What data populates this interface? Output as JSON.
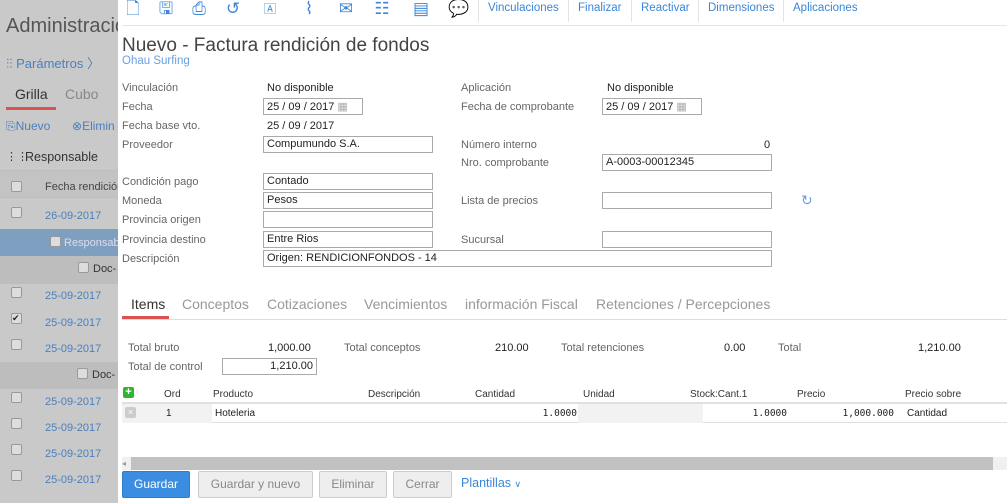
{
  "background": {
    "title": "Administració",
    "params": "Parámetros",
    "tabs": [
      "Grilla",
      "Cubo"
    ],
    "nuevo": "Nuevo",
    "eliminar": "Elimin",
    "group": "Responsable",
    "col_header": "Fecha rendición",
    "group_row": "Responsab",
    "doc_row": "Doc-",
    "rows": [
      "26-09-2017",
      "25-09-2017",
      "25-09-2017",
      "25-09-2017",
      "25-09-2017",
      "25-09-2017",
      "25-09-2017",
      "25-09-2017"
    ]
  },
  "toolbar": {
    "icons": [
      "new-doc-icon",
      "save-icon",
      "print-icon",
      "history-icon",
      "font-doc-icon",
      "attach-icon",
      "mail-icon",
      "checklist-icon",
      "document-icon",
      "comment-icon"
    ],
    "links": [
      "Vinculaciones",
      "Finalizar",
      "Reactivar",
      "Dimensiones",
      "Aplicaciones"
    ]
  },
  "header": {
    "title": "Nuevo - Factura rendición de fondos",
    "subtitle": "Ohau Surfing"
  },
  "form": {
    "vinculacion_label": "Vinculación",
    "vinculacion": "No disponible",
    "aplicacion_label": "Aplicación",
    "aplicacion": "No disponible",
    "fecha_label": "Fecha",
    "fecha": {
      "d": "25",
      "m": "09",
      "y": "2017"
    },
    "fecha_comp_label": "Fecha de comprobante",
    "fecha_comp": {
      "d": "25",
      "m": "09",
      "y": "2017"
    },
    "fecha_vto_label": "Fecha base vto.",
    "fecha_vto": "25 / 09 / 2017",
    "proveedor_label": "Proveedor",
    "proveedor": "Compumundo S.A.",
    "num_interno_label": "Número interno",
    "num_interno": "0",
    "nro_comp_label": "Nro. comprobante",
    "nro_comp": "A-0003-00012345",
    "condicion_label": "Condición pago",
    "condicion": "Contado",
    "moneda_label": "Moneda",
    "moneda": "Pesos",
    "lista_label": "Lista de precios",
    "lista": "",
    "prov_origen_label": "Provincia origen",
    "prov_origen": "",
    "prov_destino_label": "Provincia destino",
    "prov_destino": "Entre Rios",
    "sucursal_label": "Sucursal",
    "sucursal": "",
    "descripcion_label": "Descripción",
    "descripcion": "Origen: RENDICIONFONDOS - 14"
  },
  "tabs": [
    "Items",
    "Conceptos",
    "Cotizaciones",
    "Vencimientos",
    "información Fiscal",
    "Retenciones / Percepciones"
  ],
  "totals": {
    "bruto_label": "Total bruto",
    "bruto": "1,000.00",
    "conceptos_label": "Total conceptos",
    "conceptos": "210.00",
    "retenciones_label": "Total retenciones",
    "retenciones": "0.00",
    "total_label": "Total",
    "total": "1,210.00",
    "control_label": "Total de control",
    "control": "1,210.00"
  },
  "grid": {
    "headers": [
      "Ord",
      "Producto",
      "Descripción",
      "Cantidad",
      "Unidad",
      "Stock:Cant.1",
      "Precio",
      "Precio sobre"
    ],
    "rows": [
      {
        "ord": "1",
        "producto": "Hoteleria",
        "descripcion": "",
        "cantidad": "1.0000",
        "unidad": "",
        "stock": "1.0000",
        "precio": "1,000.000",
        "precio_sobre": "Cantidad"
      }
    ]
  },
  "buttons": {
    "guardar": "Guardar",
    "guardar_nuevo": "Guardar y nuevo",
    "eliminar": "Eliminar",
    "cerrar": "Cerrar",
    "plantillas": "Plantillas"
  }
}
